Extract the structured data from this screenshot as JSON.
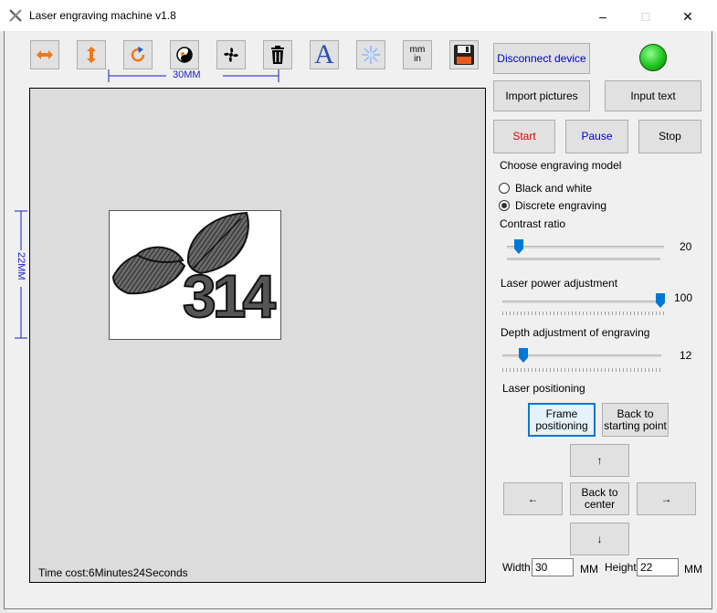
{
  "window": {
    "title": "Laser engraving machine v1.8",
    "minimize": "–",
    "maximize": "□",
    "close": "✕"
  },
  "toolbar": {
    "icons": [
      "flip-horizontal-icon",
      "flip-vertical-icon",
      "rotate-icon",
      "invert-icon",
      "fan-icon",
      "delete-icon",
      "text-icon",
      "laser-icon",
      "unit-toggle-icon",
      "save-icon"
    ],
    "unit_label_top": "mm",
    "unit_label_bottom": "in",
    "text_glyph": "A"
  },
  "dimensions": {
    "width_label": "30MM",
    "height_label": "22MM"
  },
  "canvas": {
    "time_cost": "Time cost:6Minutes24Seconds",
    "logo_text": "314"
  },
  "buttons": {
    "disconnect": "Disconnect device",
    "import_pictures": "Import pictures",
    "input_text": "Input text",
    "start": "Start",
    "pause": "Pause",
    "stop": "Stop",
    "frame_positioning": "Frame positioning",
    "back_to_start": "Back to starting point",
    "up": "↑",
    "left": "←",
    "back_to_center": "Back to center",
    "right": "→",
    "down": "↓"
  },
  "model": {
    "heading": "Choose engraving model",
    "options": [
      "Black and white",
      "Discrete engraving"
    ],
    "selected": "Discrete engraving"
  },
  "sliders": {
    "contrast": {
      "label": "Contrast ratio",
      "value": "20",
      "fraction": 0.11
    },
    "power": {
      "label": "Laser power adjustment",
      "value": "100",
      "fraction": 1.0
    },
    "depth": {
      "label": "Depth adjustment of engraving",
      "value": "12",
      "fraction": 0.12
    }
  },
  "positioning": {
    "heading": "Laser positioning"
  },
  "size": {
    "width_label": "Width",
    "width_value": "30",
    "width_unit": "MM",
    "height_label": "Height",
    "height_value": "22",
    "height_unit": "MM"
  },
  "colors": {
    "start_text": "#e00000",
    "pause_text": "#0000cc",
    "disconnect_text": "#0000cc",
    "status_led": "#22c322",
    "dimension_line": "#1a1acc"
  }
}
